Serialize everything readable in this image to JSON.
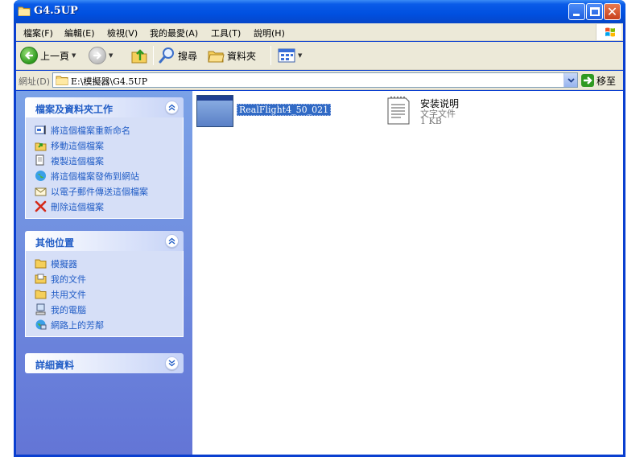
{
  "window": {
    "title": "G4.5UP"
  },
  "menu": {
    "items": [
      "檔案(F)",
      "編輯(E)",
      "檢視(V)",
      "我的最愛(A)",
      "工具(T)",
      "說明(H)"
    ]
  },
  "toolbar": {
    "back_label": "上一頁",
    "search_label": "搜尋",
    "folders_label": "資料夾"
  },
  "address": {
    "label": "網址(D)",
    "value": "E:\\模擬器\\G4.5UP",
    "go_label": "移至"
  },
  "taskpane": {
    "file_tasks": {
      "title": "檔案及資料夾工作",
      "items": [
        {
          "label": "將這個檔案重新命名",
          "icon": "rename-icon"
        },
        {
          "label": "移動這個檔案",
          "icon": "move-icon"
        },
        {
          "label": "複製這個檔案",
          "icon": "copy-icon"
        },
        {
          "label": "將這個檔案發佈到網站",
          "icon": "publish-web-icon"
        },
        {
          "label": "以電子郵件傳送這個檔案",
          "icon": "email-icon"
        },
        {
          "label": "刪除這個檔案",
          "icon": "delete-icon"
        }
      ]
    },
    "other_places": {
      "title": "其他位置",
      "items": [
        {
          "label": "模擬器",
          "icon": "folder-icon"
        },
        {
          "label": "我的文件",
          "icon": "my-documents-icon"
        },
        {
          "label": "共用文件",
          "icon": "shared-folder-icon"
        },
        {
          "label": "我的電腦",
          "icon": "my-computer-icon"
        },
        {
          "label": "網路上的芳鄰",
          "icon": "network-icon"
        }
      ]
    },
    "details": {
      "title": "詳細資料"
    }
  },
  "files": [
    {
      "name": "RealFlight4_50_021",
      "selected": true,
      "icon": "application-window-icon"
    },
    {
      "name": "安装说明",
      "type": "文字文件",
      "size": "1 KB",
      "icon": "text-document-icon"
    }
  ],
  "colors": {
    "titlebar": "#0a5be8",
    "taskpane_link": "#215dc6",
    "selection": "#316ac5"
  }
}
